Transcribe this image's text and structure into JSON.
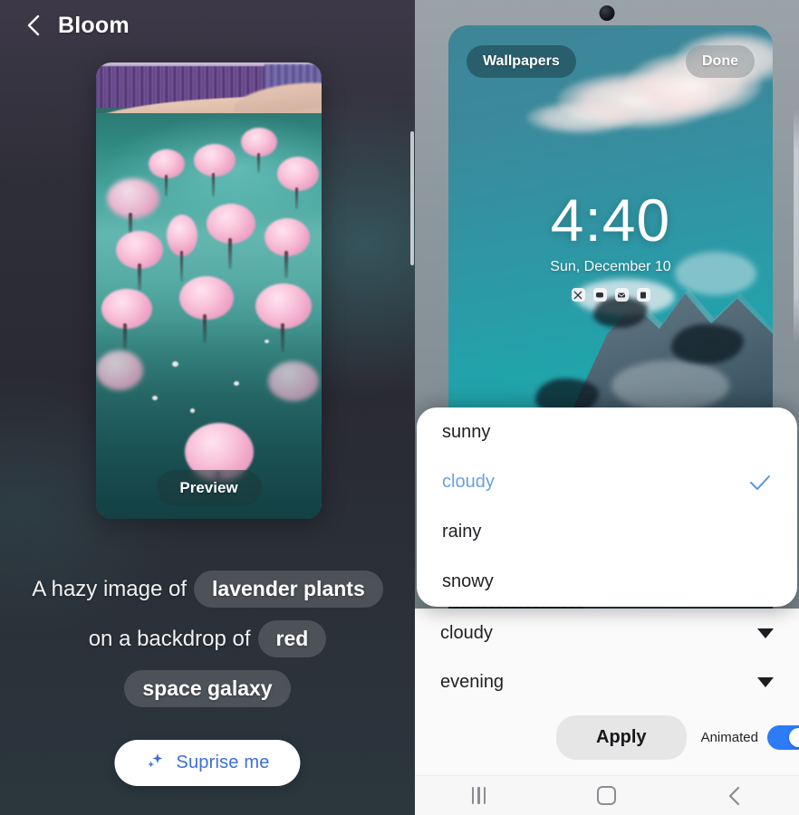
{
  "app": {
    "title": "Bloom",
    "back_icon": "back-chevron-icon"
  },
  "preview": {
    "label": "Preview",
    "image_description": "cherry blossom trees in teal lake with purple forest"
  },
  "prompt": {
    "lines": [
      {
        "static": "A hazy image of",
        "chip": "lavender plants"
      },
      {
        "static": "on a backdrop of",
        "chip": "red"
      },
      {
        "static": "",
        "chip": "space galaxy"
      }
    ]
  },
  "surprise": {
    "label": "Suprise me",
    "icon": "sparkle-icon",
    "accent_color": "#3d6fd4"
  },
  "lockscreen": {
    "wallpapers_label": "Wallpapers",
    "done_label": "Done",
    "time": "4:40",
    "date": "Sun, December 10",
    "notification_icons": [
      "scissors-icon",
      "message-icon",
      "mail-icon",
      "clipboard-icon"
    ]
  },
  "dropdown": {
    "open": true,
    "options": [
      {
        "label": "sunny",
        "selected": false
      },
      {
        "label": "cloudy",
        "selected": true
      },
      {
        "label": "rainy",
        "selected": false
      },
      {
        "label": "snowy",
        "selected": false
      }
    ],
    "selected_color": "#6b9fe0"
  },
  "controls": {
    "weather_select": {
      "value": "cloudy",
      "icon": "caret-down-icon"
    },
    "time_select": {
      "value": "evening",
      "icon": "caret-down-icon"
    },
    "apply_label": "Apply",
    "animated_label": "Animated",
    "animated_on": true,
    "toggle_color": "#2d7bf6"
  },
  "navbar": {
    "recents": "recents-icon",
    "home": "home-icon",
    "back": "back-icon"
  }
}
